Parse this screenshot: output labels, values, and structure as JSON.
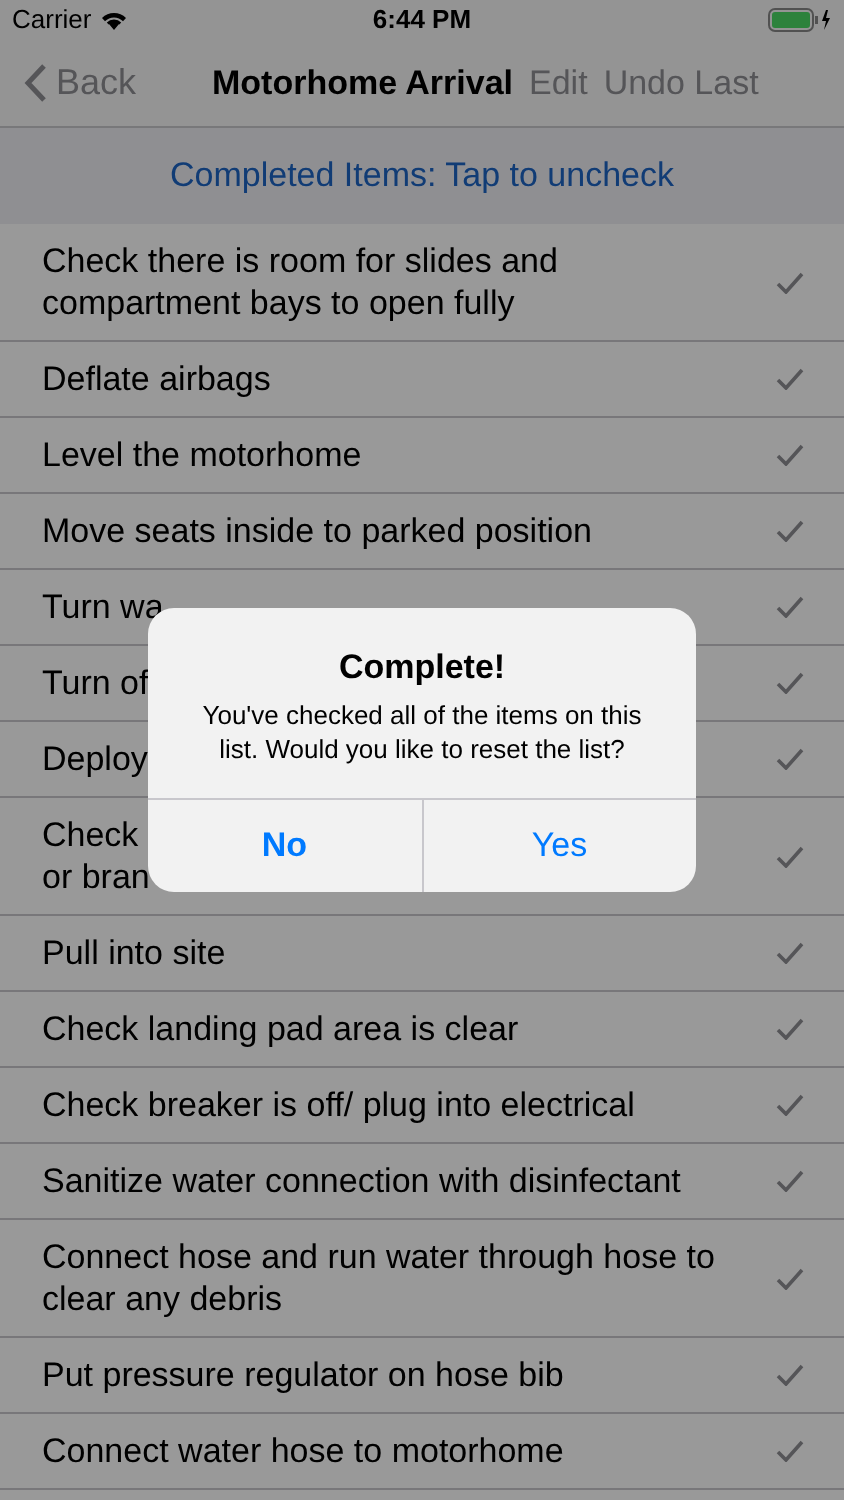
{
  "status_bar": {
    "carrier": "Carrier",
    "time": "6:44 PM"
  },
  "nav": {
    "back": "Back",
    "title": "Motorhome Arrival",
    "actions": [
      "Edit",
      "Undo Last"
    ]
  },
  "section_header": "Completed Items: Tap to uncheck",
  "items": [
    {
      "text": "Check there is room for slides and compartment bays to open fully",
      "checked": true
    },
    {
      "text": "Deflate airbags",
      "checked": true
    },
    {
      "text": "Level the motorhome",
      "checked": true
    },
    {
      "text": "Move seats inside to parked position",
      "checked": true
    },
    {
      "text": "Turn wa",
      "checked": true
    },
    {
      "text": "Turn of",
      "checked": true
    },
    {
      "text": "Deploy",
      "checked": true
    },
    {
      "text": "Check\nor bran",
      "checked": true
    },
    {
      "text": "Pull into site",
      "checked": true
    },
    {
      "text": "Check landing pad area is clear",
      "checked": true
    },
    {
      "text": "Check breaker is off/ plug into electrical",
      "checked": true
    },
    {
      "text": "Sanitize water connection with disinfectant",
      "checked": true
    },
    {
      "text": "Connect hose and run water through hose to clear any debris",
      "checked": true
    },
    {
      "text": "Put pressure regulator on hose bib",
      "checked": true
    },
    {
      "text": "Connect water hose to motorhome",
      "checked": true
    }
  ],
  "alert": {
    "title": "Complete!",
    "message": "You've checked all of the items on this list. Would you like to reset the list?",
    "buttons": [
      {
        "label": "No",
        "bold": true
      },
      {
        "label": "Yes",
        "bold": false
      }
    ]
  }
}
